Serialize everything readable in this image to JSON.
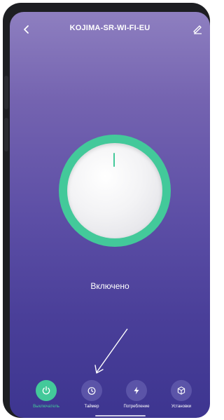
{
  "header": {
    "title": "KOJIMA-SR-WI-FI-EU",
    "back_icon": "chevron-left-icon",
    "edit_icon": "pencil-icon"
  },
  "power": {
    "status_text": "Включено",
    "accent_color": "#43c99a"
  },
  "nav": {
    "items": [
      {
        "label": "Выключатель",
        "icon": "power-icon",
        "active": true
      },
      {
        "label": "Таймер",
        "icon": "timer-icon",
        "active": false
      },
      {
        "label": "Потребление",
        "icon": "lightning-icon",
        "active": false
      },
      {
        "label": "Установки",
        "icon": "cube-icon",
        "active": false
      }
    ]
  },
  "colors": {
    "background_top": "#8e7fc0",
    "background_bottom": "#3d3590",
    "active": "#43c99a",
    "inactive_button": "#5b54a8"
  }
}
